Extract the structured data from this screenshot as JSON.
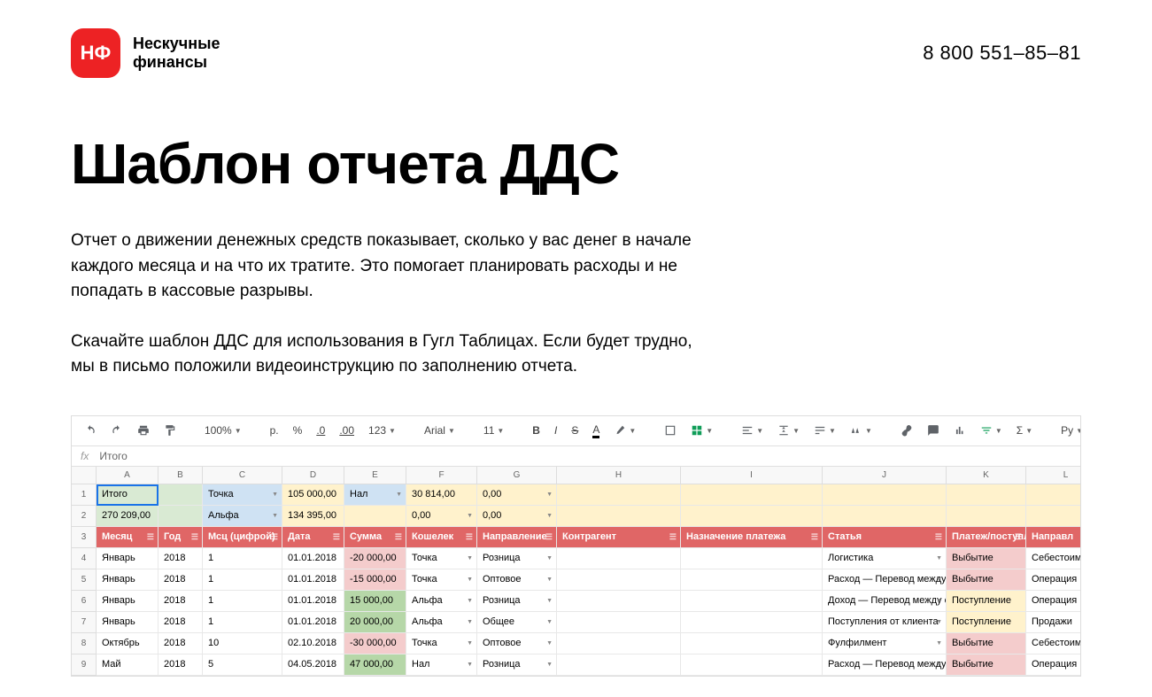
{
  "header": {
    "logo_badge": "НФ",
    "logo_line1": "Нескучные",
    "logo_line2": "финансы",
    "phone": "8 800 551–85–81"
  },
  "page": {
    "title": "Шаблон отчета ДДС",
    "p1": "Отчет о движении денежных средств показывает, сколько у вас денег в начале каждого месяца и на что их тратите. Это помогает планировать расходы и не попадать в кассовые разрывы.",
    "p2": "Скачайте шаблон ДДС для использования в Гугл Таблицах. Если будет трудно, мы в письмо положили видеоинструкцию по заполнению отчета."
  },
  "toolbar": {
    "zoom": "100%",
    "currency": "р.",
    "percent": "%",
    "dec_dec": ".0",
    "dec_inc": ".00",
    "format": "123",
    "font": "Arial",
    "size": "11"
  },
  "fx": {
    "label": "fx",
    "value": "Итого"
  },
  "cols": [
    "A",
    "B",
    "C",
    "D",
    "E",
    "F",
    "G",
    "H",
    "I",
    "J",
    "K",
    "L"
  ],
  "row1": {
    "a": "Итого",
    "c": "Точка",
    "d": "105 000,00",
    "e": "Нал",
    "f": "30 814,00",
    "g": "0,00"
  },
  "row2": {
    "a": "270 209,00",
    "c": "Альфа",
    "d": "134 395,00",
    "f": "0,00",
    "g": "0,00"
  },
  "headers": {
    "a": "Месяц",
    "b": "Год",
    "c": "Мсц (цифрой)",
    "d": "Дата",
    "e": "Сумма",
    "f": "Кошелек",
    "g": "Направление",
    "h": "Контрагент",
    "i": "Назначение платежа",
    "j": "Статья",
    "k": "Платеж/поступл",
    "l": "Направл"
  },
  "rows": [
    {
      "n": "4",
      "a": "Январь",
      "b": "2018",
      "c": "1",
      "d": "01.01.2018",
      "e": "-20 000,00",
      "f": "Точка",
      "g": "Розница",
      "j": "Логистика",
      "k": "Выбытие",
      "l": "Себестоимость",
      "ecls": "bg-pink",
      "kcls": "bg-pink"
    },
    {
      "n": "5",
      "a": "Январь",
      "b": "2018",
      "c": "1",
      "d": "01.01.2018",
      "e": "-15 000,00",
      "f": "Точка",
      "g": "Оптовое",
      "j": "Расход — Перевод между счетами",
      "k": "Выбытие",
      "l": "Операция",
      "ecls": "bg-pink",
      "kcls": "bg-pink"
    },
    {
      "n": "6",
      "a": "Январь",
      "b": "2018",
      "c": "1",
      "d": "01.01.2018",
      "e": "15 000,00",
      "f": "Альфа",
      "g": "Розница",
      "j": "Доход — Перевод между счетами",
      "k": "Поступление",
      "l": "Операция",
      "ecls": "bg-mgreen",
      "kcls": "bg-lyellow"
    },
    {
      "n": "7",
      "a": "Январь",
      "b": "2018",
      "c": "1",
      "d": "01.01.2018",
      "e": "20 000,00",
      "f": "Альфа",
      "g": "Общее",
      "j": "Поступления от клиента",
      "k": "Поступление",
      "l": "Продажи",
      "ecls": "bg-mgreen",
      "kcls": "bg-lyellow"
    },
    {
      "n": "8",
      "a": "Октябрь",
      "b": "2018",
      "c": "10",
      "d": "02.10.2018",
      "e": "-30 000,00",
      "f": "Точка",
      "g": "Оптовое",
      "j": "Фулфилмент",
      "k": "Выбытие",
      "l": "Себестоимость",
      "ecls": "bg-pink",
      "kcls": "bg-pink"
    },
    {
      "n": "9",
      "a": "Май",
      "b": "2018",
      "c": "5",
      "d": "04.05.2018",
      "e": "47 000,00",
      "f": "Нал",
      "g": "Розница",
      "j": "Расход — Перевод между счетами",
      "k": "Выбытие",
      "l": "Операция",
      "ecls": "bg-mgreen",
      "kcls": "bg-pink"
    }
  ]
}
